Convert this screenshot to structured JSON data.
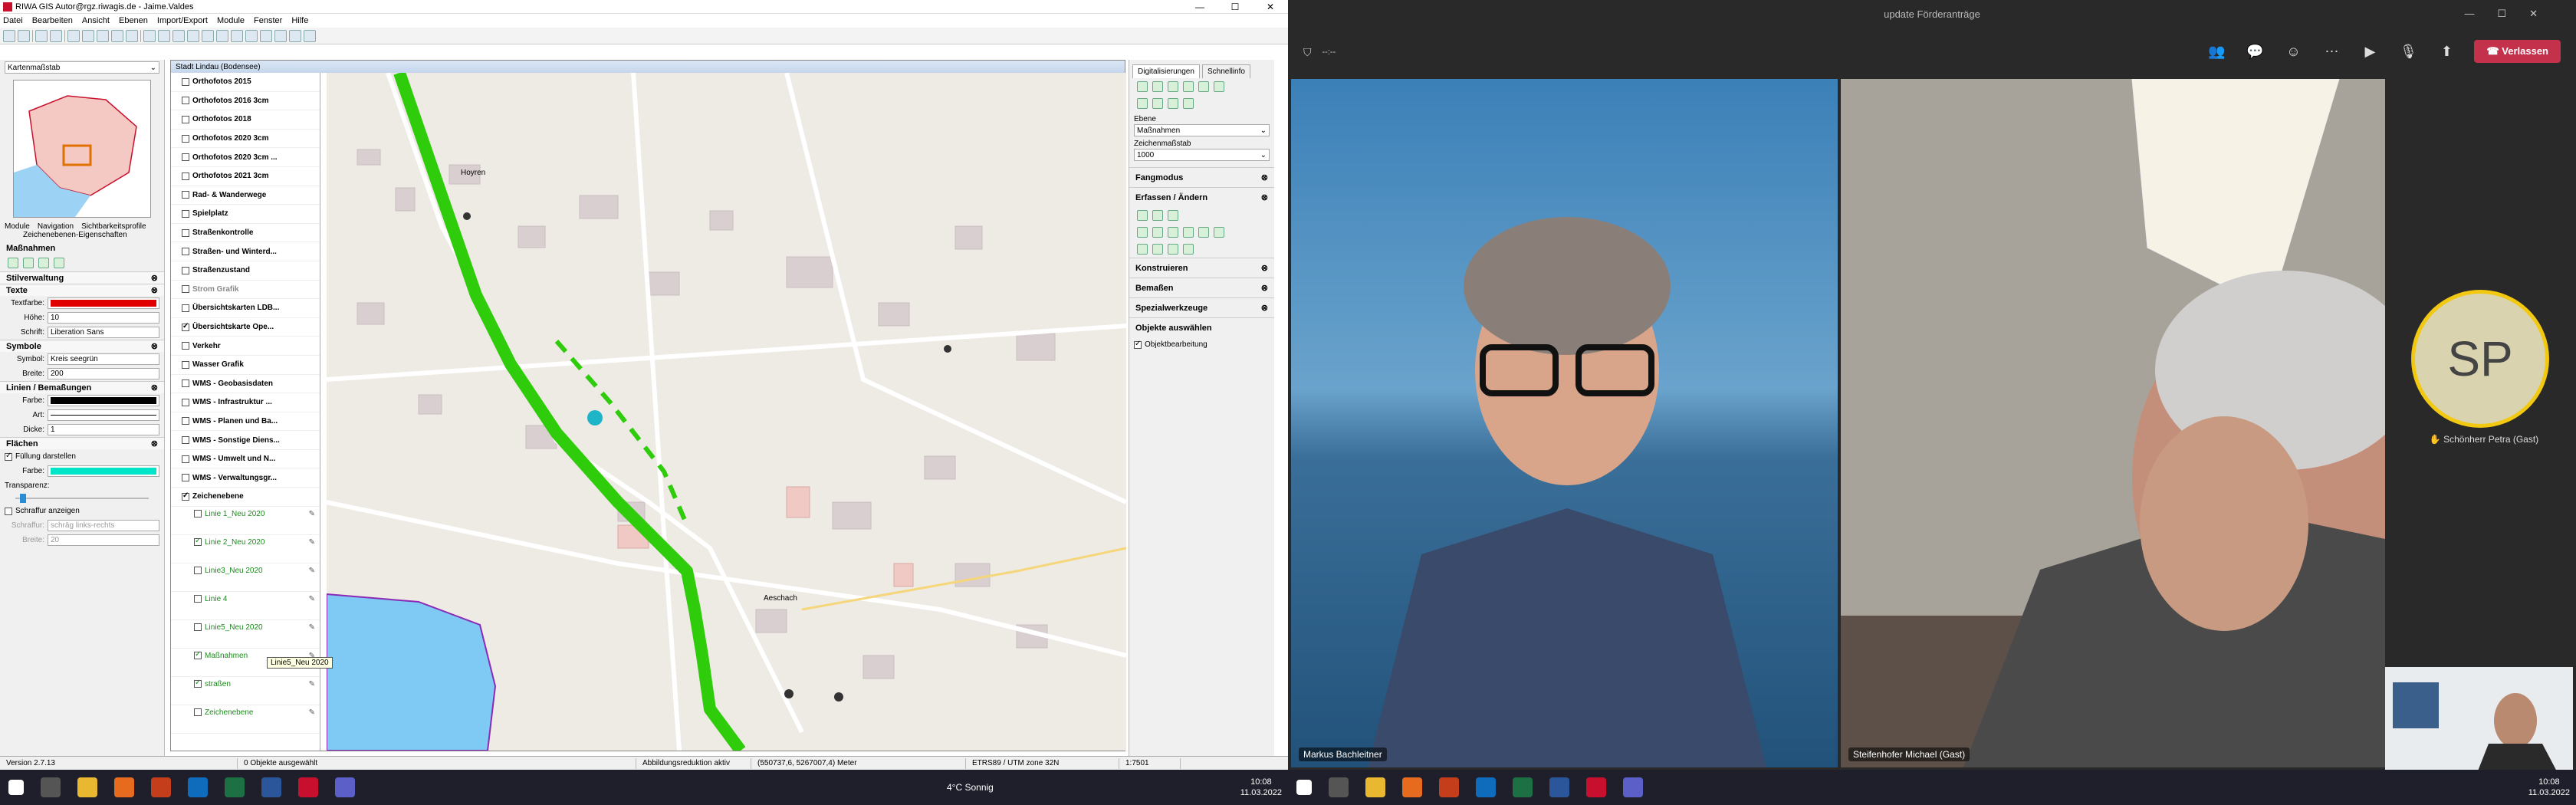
{
  "gis": {
    "window_title": "RIWA GIS Autor@rgz.riwagis.de - Jaime.Valdes",
    "menu": [
      "Datei",
      "Bearbeiten",
      "Ansicht",
      "Ebenen",
      "Import/Export",
      "Module",
      "Fenster",
      "Hilfe"
    ],
    "left": {
      "scale_combo": "Kartenmaßstab",
      "tabs": [
        "Module",
        "Navigation",
        "Sichtbarkeitsprofile"
      ],
      "subtitle": "Zeichenebenen-Eigenschaften",
      "section_massnahmen": "Maßnahmen",
      "stilverwaltung": "Stilverwaltung",
      "texte": "Texte",
      "textfarbe_label": "Textfarbe:",
      "hoehe_label": "Höhe:",
      "hoehe_value": "10",
      "schrift_label": "Schrift:",
      "schrift_value": "Liberation Sans",
      "symbole": "Symbole",
      "symbol_label": "Symbol:",
      "symbol_value": "Kreis seegrün",
      "breite_label": "Breite:",
      "breite_value": "200",
      "linien": "Linien / Bemaßungen",
      "farbe_label": "Farbe:",
      "art_label": "Art:",
      "dicke_label": "Dicke:",
      "dicke_value": "1",
      "flaechen": "Flächen",
      "fuellung": "Füllung darstellen",
      "flaechen_farbe_label": "Farbe:",
      "transparenz": "Transparenz:",
      "schraffur_anzeigen": "Schraffur anzeigen",
      "schraffur_label": "Schraffur:",
      "schraffur_value": "schräg links-rechts",
      "schraffur_breite_label": "Breite:",
      "schraffur_breite_value": "20",
      "version": "Version 2.7.13",
      "colors": {
        "text": "#e00000",
        "line": "#000000",
        "fill": "#00e5c8"
      }
    },
    "map": {
      "title": "Stadt Lindau (Bodensee)",
      "layers": [
        {
          "label": "Orthofotos 2015",
          "checked": false
        },
        {
          "label": "Orthofotos 2016 3cm",
          "checked": false
        },
        {
          "label": "Orthofotos 2018",
          "checked": false
        },
        {
          "label": "Orthofotos 2020 3cm",
          "checked": false
        },
        {
          "label": "Orthofotos 2020 3cm ...",
          "checked": false
        },
        {
          "label": "Orthofotos 2021 3cm",
          "checked": false
        },
        {
          "label": "Rad- & Wanderwege",
          "checked": false
        },
        {
          "label": "Spielplatz",
          "checked": false
        },
        {
          "label": "Straßenkontrolle",
          "checked": false
        },
        {
          "label": "Straßen- und Winterd...",
          "checked": false
        },
        {
          "label": "Straßenzustand",
          "checked": false
        },
        {
          "label": "Strom Grafik",
          "checked": false
        },
        {
          "label": "Übersichtskarten LDB...",
          "checked": false
        },
        {
          "label": "Übersichtskarte Ope...",
          "checked": true
        },
        {
          "label": "Verkehr",
          "checked": false
        },
        {
          "label": "Wasser Grafik",
          "checked": false
        },
        {
          "label": "WMS - Geobasisdaten",
          "checked": false
        },
        {
          "label": "WMS - Infrastruktur ...",
          "checked": false
        },
        {
          "label": "WMS - Planen und Ba...",
          "checked": false
        },
        {
          "label": "WMS - Sonstige Diens...",
          "checked": false
        },
        {
          "label": "WMS - Umwelt und N...",
          "checked": false
        },
        {
          "label": "WMS - Verwaltungsgr...",
          "checked": false
        },
        {
          "label": "Zeichenebene",
          "checked": true
        }
      ],
      "sublayers": [
        {
          "label": "Linie 1_Neu 2020",
          "checked": false
        },
        {
          "label": "Linie 2_Neu 2020",
          "checked": true
        },
        {
          "label": "Linie3_Neu 2020",
          "checked": false
        },
        {
          "label": "Linie 4",
          "checked": false
        },
        {
          "label": "Linie5_Neu 2020",
          "checked": false
        },
        {
          "label": "Maßnahmen",
          "checked": true
        },
        {
          "label": "straßen",
          "checked": true
        },
        {
          "label": "Zeichenebene",
          "checked": false
        }
      ],
      "tooltip": "Linie5_Neu 2020",
      "place_hoyren": "Hoyren",
      "place_aeschach": "Aeschach"
    },
    "right": {
      "tab_digitalisierungen": "Digitalisierungen",
      "tab_schnellinfo": "Schnellinfo",
      "ebene_label": "Ebene",
      "ebene_value": "Maßnahmen",
      "zeichenmassstab_label": "Zeichenmaßstab",
      "zeichenmassstab_value": "1000",
      "fangmodus": "Fangmodus",
      "erfassen": "Erfassen / Ändern",
      "konstruieren": "Konstruieren",
      "bemassen": "Bemaßen",
      "spezialwerkzeuge": "Spezialwerkzeuge",
      "objekte_auswaehlen": "Objekte auswählen",
      "objektbearbeitung": "Objektbearbeitung"
    },
    "status": {
      "selected": "0 Objekte ausgewählt",
      "reduction": "Abbildungsreduktion aktiv",
      "coords": "(550737,6, 5267007,4) Meter",
      "crs": "ETRS89 / UTM zone 32N",
      "scale": "1:7501"
    },
    "taskbar": {
      "weather": "4°C  Sonnig",
      "time": "10:08",
      "date": "11.03.2022"
    }
  },
  "teams": {
    "title": "update Förderanträge",
    "timer": "--:--",
    "leave_label": "Verlassen",
    "participants": [
      {
        "name": "Markus Bachleitner"
      },
      {
        "name": "Steifenhofer Michael (Gast)"
      }
    ],
    "avatar_initials": "SP",
    "avatar_name": "Schönherr Petra (Gast)",
    "taskbar_time": "10:08",
    "taskbar_date": "11.03.2022"
  }
}
